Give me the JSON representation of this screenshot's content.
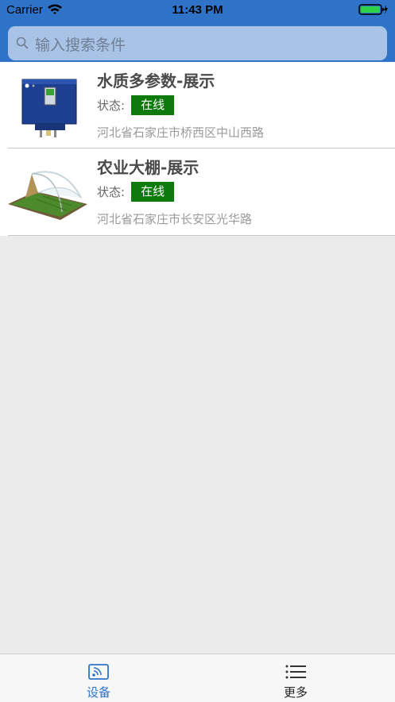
{
  "status_bar": {
    "carrier": "Carrier",
    "time": "11:43 PM"
  },
  "search": {
    "placeholder": "输入搜索条件"
  },
  "devices": [
    {
      "title": "水质多参数-展示",
      "status_label": "状态:",
      "status": "在线",
      "address": "河北省石家庄市桥西区中山西路",
      "icon": "water-quality-device-icon"
    },
    {
      "title": "农业大棚-展示",
      "status_label": "状态:",
      "status": "在线",
      "address": "河北省石家庄市长安区光华路",
      "icon": "greenhouse-icon"
    }
  ],
  "tabbar": {
    "devices_label": "设备",
    "more_label": "更多"
  },
  "colors": {
    "nav_blue": "#2f73c8",
    "online_green": "#0e7a0c",
    "tab_active": "#2f73c8"
  }
}
